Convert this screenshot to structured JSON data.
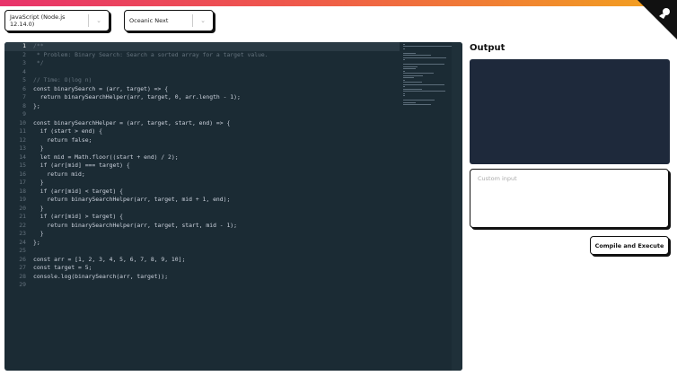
{
  "header": {
    "gradient_colors": [
      "#e8336b",
      "#f2a41e"
    ],
    "github_corner_icon": "github-octocat-icon"
  },
  "toolbar": {
    "language": "JavaScript (Node.js 12.14.0)",
    "theme": "Oceanic Next"
  },
  "editor": {
    "active_line": 1,
    "lines": [
      "/**",
      " * Problem: Binary Search: Search a sorted array for a target value.",
      " */",
      "",
      "// Time: O(log n)",
      "const binarySearch = (arr, target) => {",
      "  return binarySearchHelper(arr, target, 0, arr.length - 1);",
      "};",
      "",
      "const binarySearchHelper = (arr, target, start, end) => {",
      "  if (start > end) {",
      "    return false;",
      "  }",
      "  let mid = Math.floor((start + end) / 2);",
      "  if (arr[mid] === target) {",
      "    return mid;",
      "  }",
      "  if (arr[mid] < target) {",
      "    return binarySearchHelper(arr, target, mid + 1, end);",
      "  }",
      "  if (arr[mid] > target) {",
      "    return binarySearchHelper(arr, target, start, mid - 1);",
      "  }",
      "};",
      "",
      "const arr = [1, 2, 3, 4, 5, 6, 7, 8, 9, 10];",
      "const target = 5;",
      "console.log(binarySearch(arr, target));",
      ""
    ]
  },
  "output": {
    "title": "Output",
    "text": ""
  },
  "custom_input": {
    "placeholder": "Custom input",
    "value": ""
  },
  "run_button": {
    "label": "Compile and Execute"
  }
}
